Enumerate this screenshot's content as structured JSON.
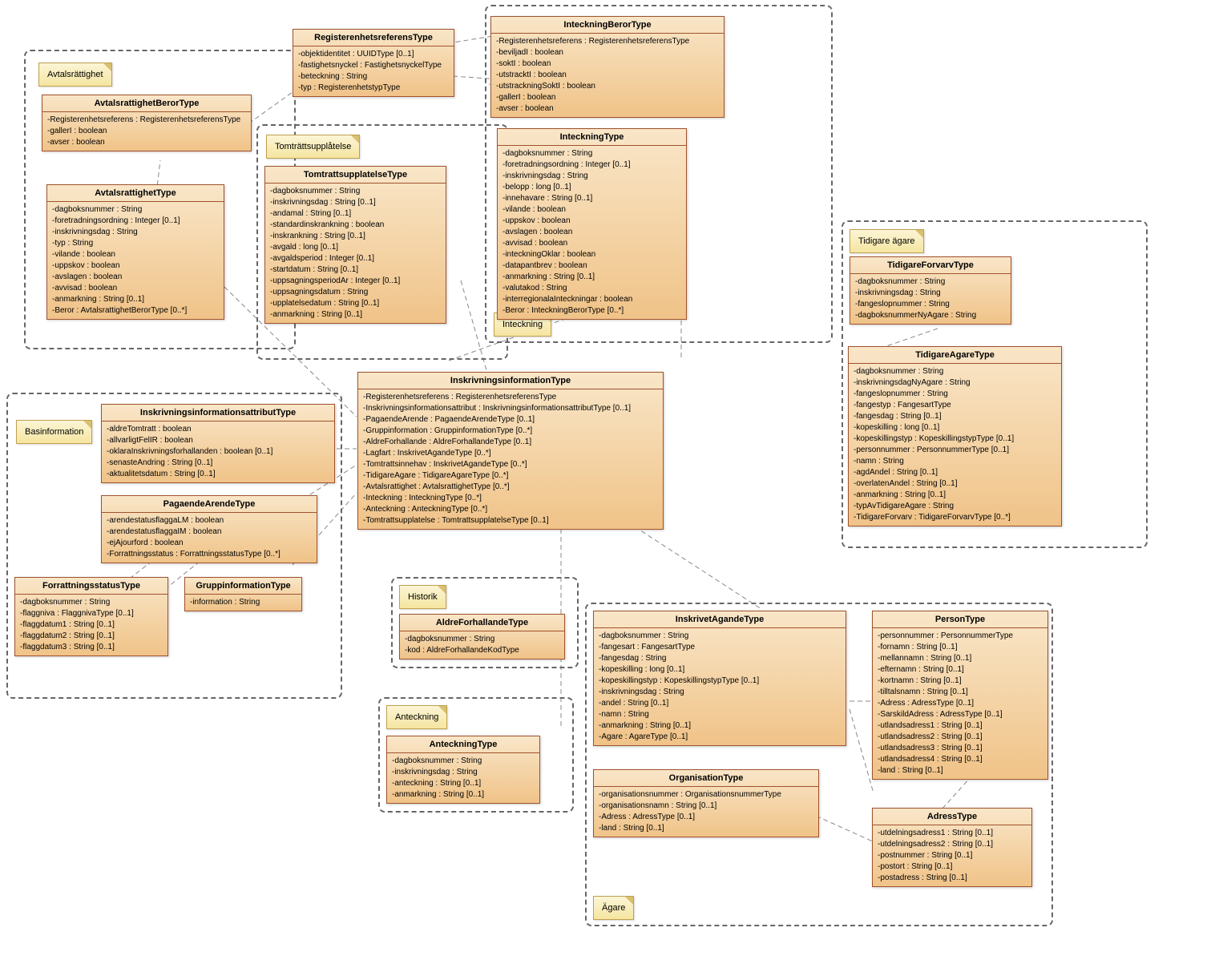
{
  "notes": {
    "avtalsrattighet": "Avtalsrättighet",
    "tomtratts": "Tomträttsupplåtelse",
    "inteckning": "Inteckning",
    "tidigare": "Tidigare ägare",
    "basinfo": "Basinformation",
    "historik": "Historik",
    "anteckning": "Anteckning",
    "agare": "Ägare"
  },
  "classes": {
    "registerenhetsref": {
      "title": "RegisterenhetsreferensType",
      "attrs": [
        "-objektidentitet : UUIDType [0..1]",
        "-fastighetsnyckel : FastighetsnyckelType",
        "-beteckning : String",
        "-typ : RegisterenhetstypType"
      ]
    },
    "inteckningberor": {
      "title": "InteckningBerorType",
      "attrs": [
        "-Registerenhetsreferens : RegisterenhetsreferensType",
        "-beviljadI : boolean",
        "-soktI : boolean",
        "-utstracktI : boolean",
        "-utstrackningSoktI : boolean",
        "-gallerI : boolean",
        "-avser : boolean"
      ]
    },
    "avtalsrattighetberor": {
      "title": "AvtalsrattighetBerorType",
      "attrs": [
        "-Registerenhetsreferens : RegisterenhetsreferensType",
        "-gallerI : boolean",
        "-avser : boolean"
      ]
    },
    "avtalsrattighet": {
      "title": "AvtalsrattighetType",
      "attrs": [
        "-dagboksnummer : String",
        "-foretradningsordning : Integer [0..1]",
        "-inskrivningsdag : String",
        "-typ : String",
        "-vilande : boolean",
        "-uppskov : boolean",
        "-avslagen : boolean",
        "-avvisad : boolean",
        "-anmarkning : String [0..1]",
        "-Beror : AvtalsrattighetBerorType [0..*]"
      ]
    },
    "tomtrattsupplatelse": {
      "title": "TomtrattsupplatelseType",
      "attrs": [
        "-dagboksnummer : String",
        "-inskrivningsdag : String [0..1]",
        "-andamal : String [0..1]",
        "-standardinskrankning : boolean",
        "-inskrankning : String [0..1]",
        "-avgald : long [0..1]",
        "-avgaldsperiod : Integer [0..1]",
        "-startdatum : String [0..1]",
        "-uppsagningsperiodAr : Integer [0..1]",
        "-uppsagningsdatum : String",
        "-upplatelsedatum : String [0..1]",
        "-anmarkning : String [0..1]"
      ]
    },
    "inteckning": {
      "title": "InteckningType",
      "attrs": [
        "-dagboksnummer : String",
        "-foretradningsordning : Integer [0..1]",
        "-inskrivningsdag : String",
        "-belopp : long [0..1]",
        "-innehavare : String [0..1]",
        "-vilande : boolean",
        "-uppskov : boolean",
        "-avslagen : boolean",
        "-avvisad : boolean",
        "-inteckningOklar : boolean",
        "-datapantbrev : boolean",
        "-anmarkning : String [0..1]",
        "-valutakod : String",
        "-interregionalaInteckningar : boolean",
        "-Beror : InteckningBerorType [0..*]"
      ]
    },
    "tidigareforvarv": {
      "title": "TidigareForvarvType",
      "attrs": [
        "-dagboksnummer : String",
        "-inskrivningsdag : String",
        "-fangeslopnummer : String",
        "-dagboksnummerNyAgare : String"
      ]
    },
    "tidigareagare": {
      "title": "TidigareAgareType",
      "attrs": [
        "-dagboksnummer : String",
        "-inskrivningsdagNyAgare : String",
        "-fangeslopnummer : String",
        "-fangestyp : FangesartType",
        "-fangesdag : String [0..1]",
        "-kopeskilling : long [0..1]",
        "-kopeskillingstyp : KopeskillingstypType [0..1]",
        "-personnummer : PersonnummerType [0..1]",
        "-namn : String",
        "-agdAndel : String [0..1]",
        "-overlatenAndel : String [0..1]",
        "-anmarkning : String [0..1]",
        "-typAvTidigareAgare : String",
        "-TidigareForvarv : TidigareForvarvType [0..*]"
      ]
    },
    "inskrivningsinformation": {
      "title": "InskrivningsinformationType",
      "attrs": [
        "-Registerenhetsreferens : RegisterenhetsreferensType",
        "-Inskrivningsinformationsattribut : InskrivningsinformationsattributType [0..1]",
        "-PagaendeArende : PagaendeArendeType [0..1]",
        "-Gruppinformation : GruppinformationType [0..*]",
        "-AldreForhallande : AldreForhallandeType [0..1]",
        "-Lagfart : InskrivetAgandeType [0..*]",
        "-Tomtrattsinnehav : InskrivetAgandeType [0..*]",
        "-TidigareAgare : TidigareAgareType [0..*]",
        "-Avtalsrattighet : AvtalsrattighetType [0..*]",
        "-Inteckning : InteckningType [0..*]",
        "-Anteckning : AnteckningType [0..*]",
        "-Tomtrattsupplatelse : TomtrattsupplatelseType [0..1]"
      ]
    },
    "inskrattribut": {
      "title": "InskrivningsinformationsattributType",
      "attrs": [
        "-aldreTomtratt : boolean",
        "-allvarligtFelIR : boolean",
        "-oklaraInskrivningsforhallanden : boolean [0..1]",
        "-senasteAndring : String [0..1]",
        "-aktualitetsdatum : String [0..1]"
      ]
    },
    "pagaende": {
      "title": "PagaendeArendeType",
      "attrs": [
        "-arendestatusflaggaLM : boolean",
        "-arendestatusflaggaIM : boolean",
        "-ejAjourford : boolean",
        "-Forrattningsstatus : ForrattningsstatusType [0..*]"
      ]
    },
    "gruppinfo": {
      "title": "GruppinformationType",
      "attrs": [
        "-information : String"
      ]
    },
    "forrattning": {
      "title": "ForrattningsstatusType",
      "attrs": [
        "-dagboksnummer : String",
        "-flaggniva : FlaggnivaType [0..1]",
        "-flaggdatum1 : String [0..1]",
        "-flaggdatum2 : String [0..1]",
        "-flaggdatum3 : String [0..1]"
      ]
    },
    "aldreforhallande": {
      "title": "AldreForhallandeType",
      "attrs": [
        "-dagboksnummer : String",
        "-kod : AldreForhallandeKodType"
      ]
    },
    "anteckning": {
      "title": "AnteckningType",
      "attrs": [
        "-dagboksnummer : String",
        "-inskrivningsdag : String",
        "-anteckning : String [0..1]",
        "-anmarkning : String [0..1]"
      ]
    },
    "inskrivetagande": {
      "title": "InskrivetAgandeType",
      "attrs": [
        "-dagboksnummer : String",
        "-fangesart : FangesartType",
        "-fangesdag : String",
        "-kopeskilling : long [0..1]",
        "-kopeskillingstyp : KopeskillingstypType [0..1]",
        "-inskrivningsdag : String",
        "-andel : String [0..1]",
        "-namn : String",
        "-anmarkning : String [0..1]",
        "-Agare : AgareType [0..1]"
      ]
    },
    "organisation": {
      "title": "OrganisationType",
      "attrs": [
        "-organisationsnummer : OrganisationsnummerType",
        "-organisationsnamn : String [0..1]",
        "-Adress : AdressType [0..1]",
        "-land : String [0..1]"
      ]
    },
    "person": {
      "title": "PersonType",
      "attrs": [
        "-personnummer : PersonnummerType",
        "-fornamn : String [0..1]",
        "-mellannamn : String [0..1]",
        "-efternamn : String [0..1]",
        "-kortnamn : String [0..1]",
        "-tilltalsnamn : String [0..1]",
        "-Adress : AdressType [0..1]",
        "-SarskildAdress : AdressType [0..1]",
        "-utlandsadress1 : String [0..1]",
        "-utlandsadress2 : String [0..1]",
        "-utlandsadress3 : String [0..1]",
        "-utlandsadress4 : String [0..1]",
        "-land : String [0..1]"
      ]
    },
    "adress": {
      "title": "AdressType",
      "attrs": [
        "-utdelningsadress1 : String [0..1]",
        "-utdelningsadress2 : String [0..1]",
        "-postnummer : String [0..1]",
        "-postort : String [0..1]",
        "-postadress : String [0..1]"
      ]
    }
  }
}
